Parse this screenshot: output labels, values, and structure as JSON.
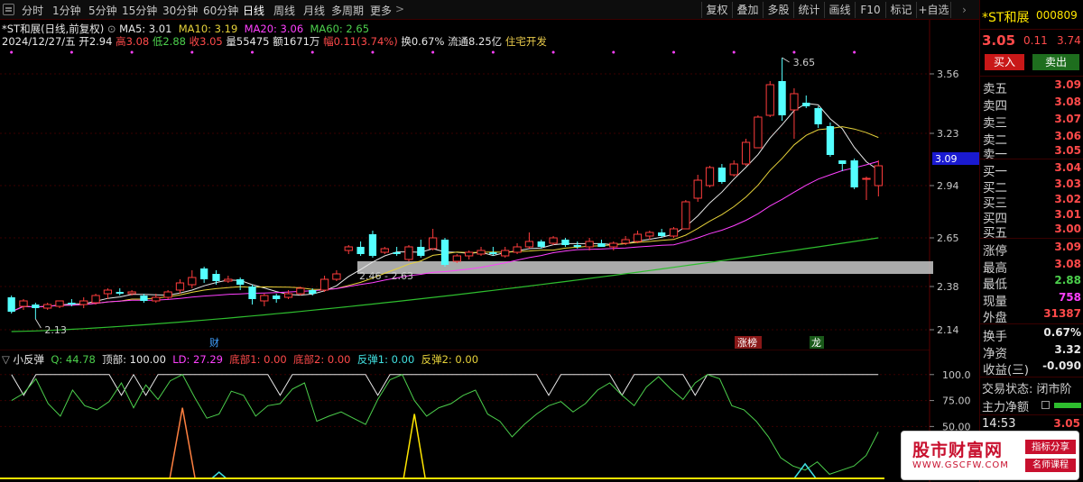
{
  "periods": [
    "分时",
    "1分钟",
    "5分钟",
    "15分钟",
    "30分钟",
    "60分钟",
    "日线",
    "周线",
    "月线",
    "多周期",
    "更多"
  ],
  "active_period": "日线",
  "more_arrow": ">",
  "toolbar": [
    "复权",
    "叠加",
    "多股",
    "统计",
    "画线",
    "F10",
    "标记",
    "+自选"
  ],
  "chart_title": "*ST和展(日线,前复权)",
  "ma": {
    "ma5": "MA5: 3.01",
    "ma10": "MA10: 3.19",
    "ma20": "MA20: 3.06",
    "ma60": "MA60: 2.65"
  },
  "bar_info": {
    "date": "2024/12/27/五",
    "open": "开2.94",
    "high": "高3.08",
    "low": "低2.88",
    "close": "收3.05",
    "volume": "量55475",
    "amount": "额1671万",
    "change": "幅0.11(3.74%)",
    "turnover": "换0.67%",
    "float": "流通8.25亿",
    "concept": "住宅开发"
  },
  "price_axis": [
    "3.56",
    "3.23",
    "2.94",
    "2.65",
    "2.38",
    "2.14"
  ],
  "current_price_tag": "3.09",
  "annotations": {
    "high_label": "3.65",
    "low_label": "2.13",
    "box_label": "2.46 - 2.63",
    "tag_cai": "财",
    "tag_zhangbang": "涨榜",
    "tag_dragon": "龙"
  },
  "indicator": {
    "name": "小反弹",
    "q": "Q: 44.78",
    "top": "顶部: 100.00",
    "ld": "LD: 27.29",
    "bottom1": "底部1: 0.00",
    "bottom2": "底部2: 0.00",
    "rebound1": "反弹1: 0.00",
    "rebound2": "反弹2: 0.00",
    "axis": [
      "100.0",
      "75.00",
      "50.00"
    ]
  },
  "side": {
    "name": "*ST和展",
    "code": "000809",
    "price": "3.05",
    "change": "0.11",
    "pct": "3.74",
    "buy_label": "买入",
    "sell_label": "卖出",
    "asks": [
      {
        "label": "卖五",
        "price": "3.09"
      },
      {
        "label": "卖四",
        "price": "3.08"
      },
      {
        "label": "卖三",
        "price": "3.07"
      },
      {
        "label": "卖二",
        "price": "3.06"
      },
      {
        "label": "卖一",
        "price": "3.05"
      }
    ],
    "bids": [
      {
        "label": "买一",
        "price": "3.04"
      },
      {
        "label": "买二",
        "price": "3.03"
      },
      {
        "label": "买三",
        "price": "3.02"
      },
      {
        "label": "买四",
        "price": "3.01"
      },
      {
        "label": "买五",
        "price": "3.00"
      }
    ],
    "stats": [
      {
        "label": "涨停",
        "value": "3.09",
        "color": "#ff4a4a"
      },
      {
        "label": "最高",
        "value": "3.08",
        "color": "#ff4a4a"
      },
      {
        "label": "最低",
        "value": "2.88",
        "color": "#4ccf4c"
      },
      {
        "label": "现量",
        "value": "758",
        "color": "#ff40ff"
      },
      {
        "label": "外盘",
        "value": "31387",
        "color": "#ff4a4a"
      }
    ],
    "extra": [
      {
        "label": "换手",
        "value": "0.67%",
        "color": "#e8e8e8"
      },
      {
        "label": "净资",
        "value": "3.32",
        "color": "#e8e8e8"
      },
      {
        "label": "收益(三)",
        "value": "-0.090",
        "color": "#e8e8e8"
      }
    ],
    "trade_status": "交易状态: 闭市阶",
    "main_flow": "主力净额",
    "time": "14:53",
    "time_price": "3.05"
  },
  "watermark": {
    "title": "股市财富网",
    "url": "WWW.GSCFW.COM",
    "tag1": "指标分享",
    "tag2": "名师课程"
  },
  "chart_data": {
    "type": "candlestick",
    "candles": [
      {
        "o": 2.32,
        "c": 2.24,
        "h": 2.33,
        "l": 2.23
      },
      {
        "o": 2.27,
        "c": 2.3,
        "h": 2.31,
        "l": 2.25
      },
      {
        "o": 2.28,
        "c": 2.26,
        "h": 2.29,
        "l": 2.2
      },
      {
        "o": 2.26,
        "c": 2.28,
        "h": 2.29,
        "l": 2.25
      },
      {
        "o": 2.27,
        "c": 2.3,
        "h": 2.3,
        "l": 2.26
      },
      {
        "o": 2.29,
        "c": 2.28,
        "h": 2.31,
        "l": 2.27
      },
      {
        "o": 2.28,
        "c": 2.3,
        "h": 2.32,
        "l": 2.26
      },
      {
        "o": 2.29,
        "c": 2.33,
        "h": 2.34,
        "l": 2.28
      },
      {
        "o": 2.34,
        "c": 2.36,
        "h": 2.37,
        "l": 2.31
      },
      {
        "o": 2.35,
        "c": 2.34,
        "h": 2.37,
        "l": 2.33
      },
      {
        "o": 2.34,
        "c": 2.35,
        "h": 2.36,
        "l": 2.33
      },
      {
        "o": 2.33,
        "c": 2.3,
        "h": 2.34,
        "l": 2.29
      },
      {
        "o": 2.3,
        "c": 2.32,
        "h": 2.34,
        "l": 2.29
      },
      {
        "o": 2.32,
        "c": 2.35,
        "h": 2.36,
        "l": 2.31
      },
      {
        "o": 2.36,
        "c": 2.4,
        "h": 2.42,
        "l": 2.34
      },
      {
        "o": 2.39,
        "c": 2.43,
        "h": 2.47,
        "l": 2.37
      },
      {
        "o": 2.48,
        "c": 2.42,
        "h": 2.49,
        "l": 2.4
      },
      {
        "o": 2.45,
        "c": 2.41,
        "h": 2.47,
        "l": 2.39
      },
      {
        "o": 2.41,
        "c": 2.42,
        "h": 2.44,
        "l": 2.4
      },
      {
        "o": 2.42,
        "c": 2.39,
        "h": 2.43,
        "l": 2.36
      },
      {
        "o": 2.38,
        "c": 2.31,
        "h": 2.39,
        "l": 2.28
      },
      {
        "o": 2.3,
        "c": 2.33,
        "h": 2.34,
        "l": 2.27
      },
      {
        "o": 2.33,
        "c": 2.31,
        "h": 2.34,
        "l": 2.29
      },
      {
        "o": 2.32,
        "c": 2.34,
        "h": 2.36,
        "l": 2.31
      },
      {
        "o": 2.34,
        "c": 2.37,
        "h": 2.38,
        "l": 2.33
      },
      {
        "o": 2.36,
        "c": 2.34,
        "h": 2.37,
        "l": 2.33
      },
      {
        "o": 2.36,
        "c": 2.42,
        "h": 2.44,
        "l": 2.35
      },
      {
        "o": 2.42,
        "c": 2.45,
        "h": 2.47,
        "l": 2.41
      },
      {
        "o": 2.58,
        "c": 2.6,
        "h": 2.61,
        "l": 2.56
      },
      {
        "o": 2.6,
        "c": 2.56,
        "h": 2.63,
        "l": 2.55
      },
      {
        "o": 2.67,
        "c": 2.55,
        "h": 2.69,
        "l": 2.54
      },
      {
        "o": 2.57,
        "c": 2.59,
        "h": 2.6,
        "l": 2.56
      },
      {
        "o": 2.57,
        "c": 2.56,
        "h": 2.6,
        "l": 2.55
      },
      {
        "o": 2.53,
        "c": 2.6,
        "h": 2.61,
        "l": 2.52
      },
      {
        "o": 2.6,
        "c": 2.55,
        "h": 2.64,
        "l": 2.54
      },
      {
        "o": 2.59,
        "c": 2.65,
        "h": 2.7,
        "l": 2.58
      },
      {
        "o": 2.64,
        "c": 2.5,
        "h": 2.65,
        "l": 2.49
      },
      {
        "o": 2.52,
        "c": 2.55,
        "h": 2.56,
        "l": 2.51
      },
      {
        "o": 2.55,
        "c": 2.57,
        "h": 2.58,
        "l": 2.53
      },
      {
        "o": 2.56,
        "c": 2.58,
        "h": 2.6,
        "l": 2.55
      },
      {
        "o": 2.57,
        "c": 2.56,
        "h": 2.6,
        "l": 2.55
      },
      {
        "o": 2.55,
        "c": 2.58,
        "h": 2.6,
        "l": 2.54
      },
      {
        "o": 2.57,
        "c": 2.6,
        "h": 2.62,
        "l": 2.56
      },
      {
        "o": 2.6,
        "c": 2.63,
        "h": 2.68,
        "l": 2.59
      },
      {
        "o": 2.63,
        "c": 2.6,
        "h": 2.64,
        "l": 2.59
      },
      {
        "o": 2.62,
        "c": 2.65,
        "h": 2.66,
        "l": 2.61
      },
      {
        "o": 2.64,
        "c": 2.61,
        "h": 2.65,
        "l": 2.6
      },
      {
        "o": 2.61,
        "c": 2.6,
        "h": 2.63,
        "l": 2.59
      },
      {
        "o": 2.6,
        "c": 2.63,
        "h": 2.65,
        "l": 2.58
      },
      {
        "o": 2.62,
        "c": 2.6,
        "h": 2.64,
        "l": 2.6
      },
      {
        "o": 2.6,
        "c": 2.62,
        "h": 2.63,
        "l": 2.58
      },
      {
        "o": 2.62,
        "c": 2.64,
        "h": 2.66,
        "l": 2.61
      },
      {
        "o": 2.63,
        "c": 2.67,
        "h": 2.69,
        "l": 2.62
      },
      {
        "o": 2.66,
        "c": 2.68,
        "h": 2.69,
        "l": 2.64
      },
      {
        "o": 2.68,
        "c": 2.66,
        "h": 2.7,
        "l": 2.65
      },
      {
        "o": 2.66,
        "c": 2.7,
        "h": 2.71,
        "l": 2.65
      },
      {
        "o": 2.7,
        "c": 2.85,
        "h": 2.86,
        "l": 2.7
      },
      {
        "o": 2.87,
        "c": 2.97,
        "h": 3.0,
        "l": 2.85
      },
      {
        "o": 2.94,
        "c": 3.04,
        "h": 3.05,
        "l": 2.93
      },
      {
        "o": 3.04,
        "c": 2.96,
        "h": 3.06,
        "l": 2.95
      },
      {
        "o": 3.0,
        "c": 3.06,
        "h": 3.08,
        "l": 2.99
      },
      {
        "o": 3.06,
        "c": 3.18,
        "h": 3.2,
        "l": 3.05
      },
      {
        "o": 3.15,
        "c": 3.32,
        "h": 3.33,
        "l": 3.15
      },
      {
        "o": 3.33,
        "c": 3.5,
        "h": 3.52,
        "l": 3.32
      },
      {
        "o": 3.52,
        "c": 3.33,
        "h": 3.65,
        "l": 3.3
      },
      {
        "o": 3.36,
        "c": 3.45,
        "h": 3.48,
        "l": 3.2
      },
      {
        "o": 3.4,
        "c": 3.38,
        "h": 3.44,
        "l": 3.37
      },
      {
        "o": 3.37,
        "c": 3.28,
        "h": 3.38,
        "l": 3.26
      },
      {
        "o": 3.27,
        "c": 3.11,
        "h": 3.29,
        "l": 3.1
      },
      {
        "o": 3.08,
        "c": 3.06,
        "h": 3.08,
        "l": 3.02
      },
      {
        "o": 3.08,
        "c": 2.93,
        "h": 3.09,
        "l": 2.92
      },
      {
        "o": 2.98,
        "c": 2.98,
        "h": 2.99,
        "l": 2.86
      },
      {
        "o": 2.94,
        "c": 3.05,
        "h": 3.08,
        "l": 2.88
      }
    ],
    "ma5_tail": 3.01,
    "ma10_tail": 3.19,
    "ma20_tail": 3.06,
    "ma60_tail": 2.65,
    "ylim": [
      2.08,
      3.72
    ],
    "indicator_q": [
      75,
      82,
      96,
      72,
      60,
      85,
      70,
      66,
      74,
      92,
      68,
      90,
      76,
      94,
      100,
      78,
      58,
      62,
      84,
      80,
      60,
      70,
      72,
      86,
      92,
      55,
      60,
      64,
      58,
      52,
      76,
      95,
      100,
      75,
      60,
      68,
      72,
      80,
      85,
      62,
      55,
      40,
      52,
      62,
      70,
      74,
      64,
      72,
      85,
      92,
      80,
      70,
      88,
      98,
      86,
      76,
      92,
      100,
      96,
      70,
      66,
      55,
      40,
      20,
      12,
      8,
      16,
      4,
      8,
      12,
      22,
      44.78
    ],
    "indicator_top": [
      100,
      80,
      100,
      100,
      100,
      100,
      100,
      100,
      100,
      80,
      100,
      80,
      100,
      100,
      100,
      100,
      100,
      100,
      100,
      100,
      100,
      100,
      80,
      100,
      100,
      100,
      100,
      100,
      100,
      100,
      80,
      100,
      100,
      100,
      100,
      100,
      100,
      100,
      100,
      100,
      100,
      100,
      100,
      100,
      80,
      100,
      100,
      100,
      100,
      100,
      80,
      100,
      100,
      100,
      100,
      100,
      80,
      100,
      100,
      100,
      100,
      100,
      100,
      100,
      100,
      100,
      100,
      100,
      100,
      100,
      100,
      100
    ],
    "indicator_ylim": [
      0,
      105
    ]
  }
}
